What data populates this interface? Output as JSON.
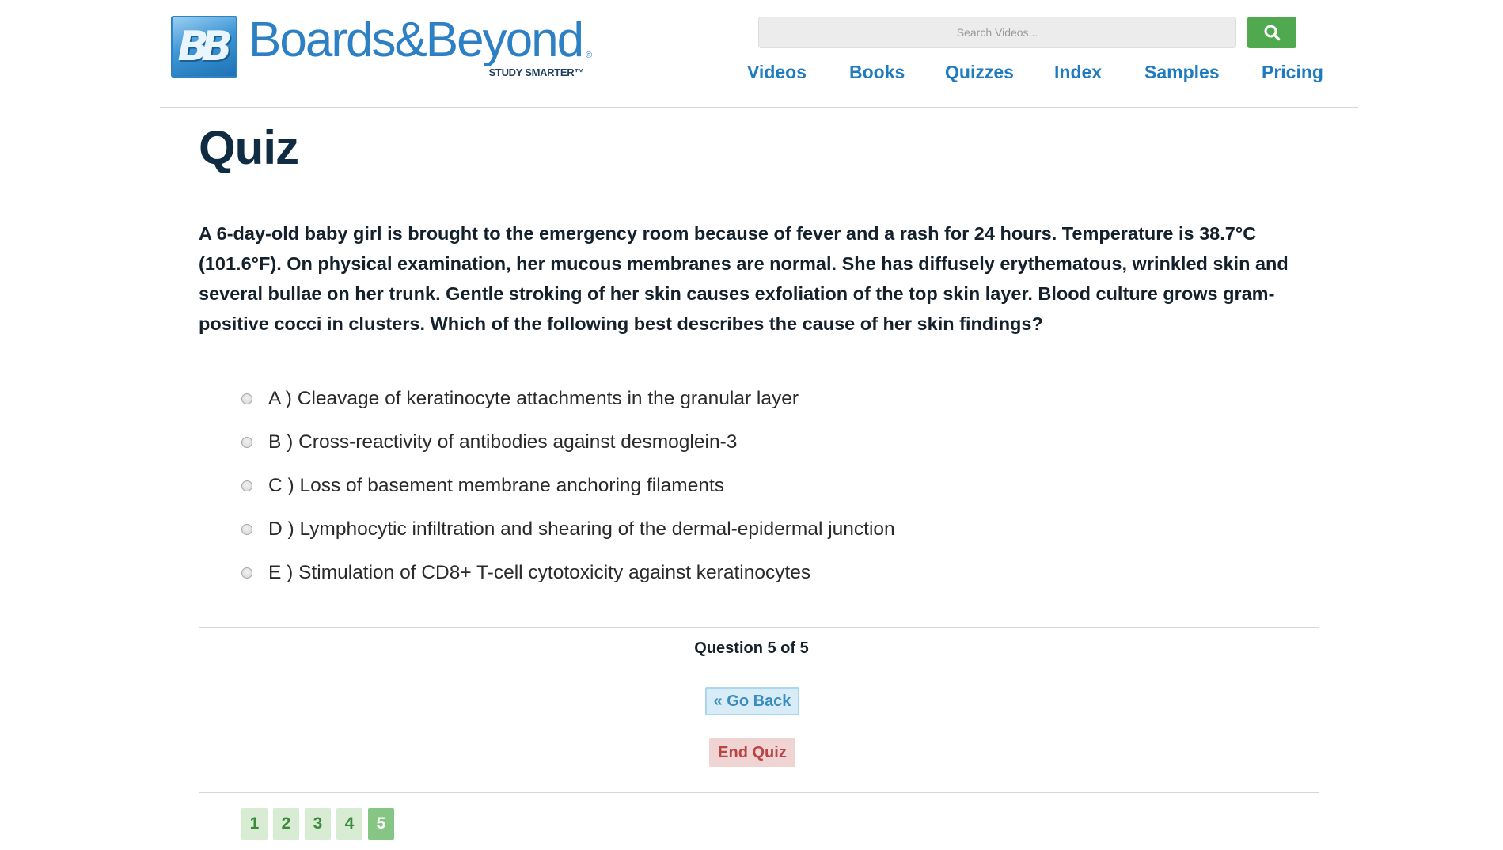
{
  "brand": {
    "logo_mark": "BB",
    "name": "Boards&Beyond",
    "registered": "®",
    "tagline": "STUDY SMARTER™"
  },
  "search": {
    "placeholder": "Search Videos...",
    "button_icon": "search-icon",
    "button_color": "#50a84f"
  },
  "nav": {
    "items": [
      {
        "label": "Videos"
      },
      {
        "label": "Books"
      },
      {
        "label": "Quizzes"
      },
      {
        "label": "Index"
      },
      {
        "label": "Samples"
      },
      {
        "label": "Pricing"
      }
    ]
  },
  "page": {
    "title": "Quiz"
  },
  "quiz": {
    "question": "A 6-day-old baby girl is brought to the emergency room because of fever and a rash for 24 hours. Temperature is 38.7°C (101.6°F). On physical examination, her mucous membranes are normal. She has diffusely erythematous, wrinkled skin and several bullae on her trunk. Gentle stroking of her skin causes exfoliation of the top skin layer. Blood culture grows gram-positive cocci in clusters. Which of the following best describes the cause of her skin findings?",
    "options": [
      {
        "letter": "A",
        "label": "A ) Cleavage of keratinocyte attachments in the granular layer",
        "selected": false
      },
      {
        "letter": "B",
        "label": "B ) Cross-reactivity of antibodies against desmoglein-3",
        "selected": false
      },
      {
        "letter": "C",
        "label": "C ) Loss of basement membrane anchoring filaments",
        "selected": false
      },
      {
        "letter": "D",
        "label": "D ) Lymphocytic infiltration and shearing of the dermal-epidermal junction",
        "selected": false
      },
      {
        "letter": "E",
        "label": "E ) Stimulation of CD8+ T-cell cytotoxicity against keratinocytes",
        "selected": false
      }
    ],
    "counter": "Question 5 of 5",
    "go_back_label": "« Go Back",
    "end_quiz_label": "End Quiz",
    "pages": [
      "1",
      "2",
      "3",
      "4",
      "5"
    ],
    "current_page": "5"
  },
  "colors": {
    "link": "#1f7bc0",
    "title": "#0f2c42",
    "page_button": "#d7ecd2",
    "page_button_active": "#86c685",
    "go_back_bg": "#d7ecf6",
    "end_quiz_bg": "#f0d3d3"
  }
}
